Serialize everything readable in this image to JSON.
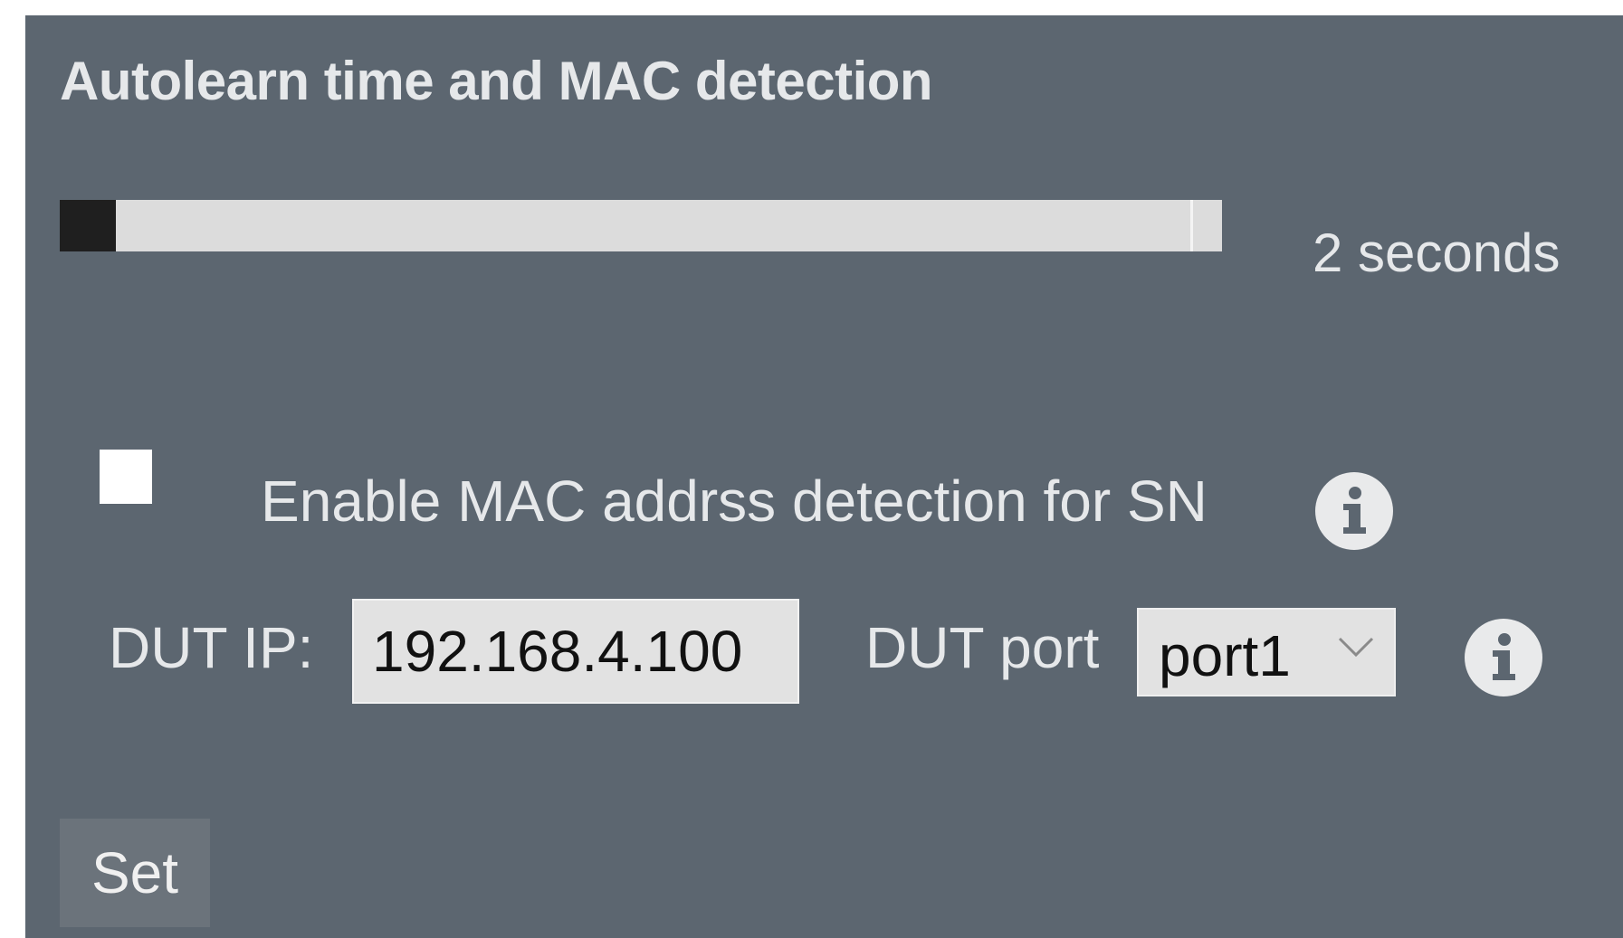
{
  "panel": {
    "title": "Autolearn time and MAC detection"
  },
  "autolearn": {
    "slider_fraction": 0.0,
    "time_display": "2 seconds"
  },
  "mac_detection": {
    "checked": false,
    "label": "Enable MAC addrss detection for SN",
    "info_icon": "info-icon"
  },
  "dut": {
    "ip_label": "DUT IP:",
    "ip_value": "192.168.4.100",
    "port_label": "DUT port",
    "port_selected": "port1",
    "port_chevron_icon": "chevron-down-icon",
    "info_icon": "info-icon"
  },
  "actions": {
    "set_label": "Set"
  },
  "colors": {
    "panel_bg": "#5c6670",
    "text": "#e6e8ea",
    "slider_track": "#dcdcdc",
    "slider_thumb": "#1f1f1f",
    "button_bg": "#6b737b"
  }
}
